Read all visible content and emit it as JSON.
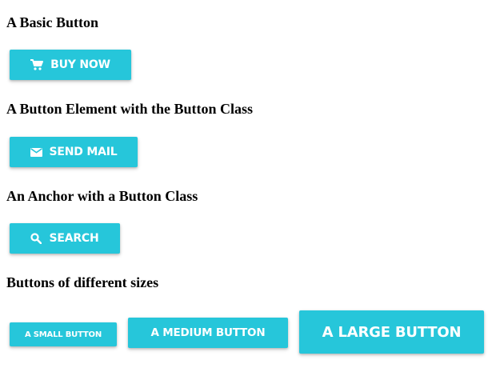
{
  "sections": [
    {
      "heading": "A Basic Button",
      "button": {
        "label": "BUY NOW",
        "icon": "cart-icon"
      }
    },
    {
      "heading": "A Button Element with the Button Class",
      "button": {
        "label": "SEND MAIL",
        "icon": "mail-icon"
      }
    },
    {
      "heading": "An Anchor with a Button Class",
      "button": {
        "label": "SEARCH",
        "icon": "search-icon"
      }
    },
    {
      "heading": "Buttons of different sizes",
      "buttons": [
        {
          "label": "A SMALL BUTTON"
        },
        {
          "label": "A MEDIUM BUTTON"
        },
        {
          "label": "A LARGE BUTTON"
        }
      ]
    }
  ],
  "colors": {
    "button_background": "#26c6da",
    "button_text": "#ffffff",
    "heading_text": "#000000"
  }
}
